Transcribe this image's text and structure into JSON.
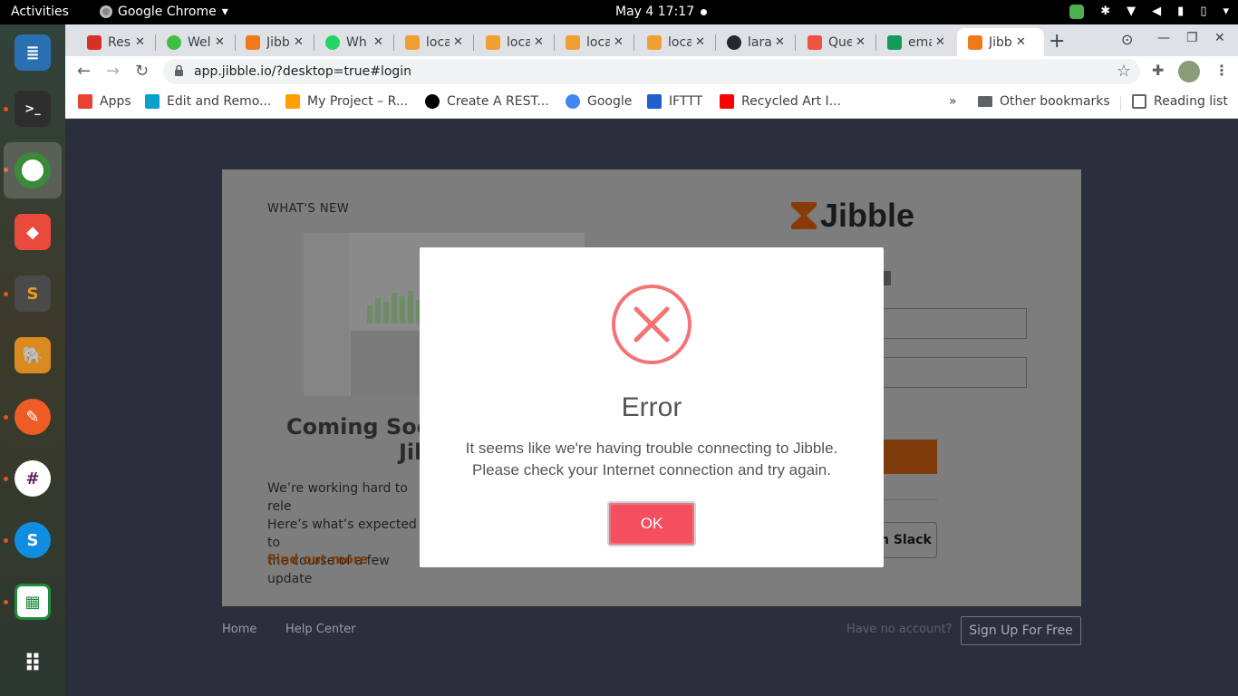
{
  "topbar": {
    "activities": "Activities",
    "app_name": "Google Chrome",
    "clock": "May 4  17:17"
  },
  "dock": {
    "items": [
      {
        "name": "text-editor-icon",
        "color": "#2a6fb0"
      },
      {
        "name": "terminal-icon",
        "color": "#2e2e2e"
      },
      {
        "name": "chrome-icon",
        "color": "#3a8a3a"
      },
      {
        "name": "anydesk-icon",
        "color": "#e84a3b"
      },
      {
        "name": "sublime-text-icon",
        "color": "#4a4a4a"
      },
      {
        "name": "dbeaver-icon",
        "color": "#d98a20"
      },
      {
        "name": "postman-icon",
        "color": "#ef5b25"
      },
      {
        "name": "slack-icon",
        "color": "#ffffff"
      },
      {
        "name": "skype-icon",
        "color": "#0f8de0"
      },
      {
        "name": "spreadsheet-icon",
        "color": "#1f8a3a"
      },
      {
        "name": "app-grid-icon",
        "color": "#ffffff"
      }
    ]
  },
  "tabs": [
    {
      "label": "Res",
      "favicon": "gmail-icon",
      "color": "#d93025"
    },
    {
      "label": "Wel",
      "favicon": "green-dot-icon",
      "color": "#3fbf3f"
    },
    {
      "label": "Jibb",
      "favicon": "jibble-icon",
      "color": "#f07a1a"
    },
    {
      "label": "Wh",
      "favicon": "whatsapp-icon",
      "color": "#25d366"
    },
    {
      "label": "loca",
      "favicon": "phpmyadmin-icon",
      "color": "#f0a030"
    },
    {
      "label": "loca",
      "favicon": "phpmyadmin-icon",
      "color": "#f0a030"
    },
    {
      "label": "loca",
      "favicon": "phpmyadmin-icon",
      "color": "#f0a030"
    },
    {
      "label": "loca",
      "favicon": "phpmyadmin-icon",
      "color": "#f0a030"
    },
    {
      "label": "lara",
      "favicon": "github-icon",
      "color": "#24292e"
    },
    {
      "label": "Que",
      "favicon": "laravel-icon",
      "color": "#f05340"
    },
    {
      "label": "ema",
      "favicon": "sheets-icon",
      "color": "#0f9d58"
    },
    {
      "label": "Jibb",
      "favicon": "jibble-icon",
      "color": "#f07a1a"
    }
  ],
  "address_bar": {
    "url": "app.jibble.io/?desktop=true#login"
  },
  "bookmarks": [
    {
      "label": "Apps",
      "icon": "apps-grid-icon",
      "color": "#e94235"
    },
    {
      "label": "Edit and Remo...",
      "icon": "bookmark-favicon",
      "color": "#0aa0c8"
    },
    {
      "label": "My Project – R...",
      "icon": "firebase-icon",
      "color": "#ffa000"
    },
    {
      "label": "Create A REST...",
      "icon": "medium-icon",
      "color": "#000000"
    },
    {
      "label": "Google",
      "icon": "google-icon",
      "color": "#4285f4"
    },
    {
      "label": "IFTTT",
      "icon": "ifttt-icon",
      "color": "#1f5fd0"
    },
    {
      "label": "Recycled Art I...",
      "icon": "youtube-icon",
      "color": "#ff0000"
    }
  ],
  "bookmarks_right": {
    "overflow": "»",
    "other": "Other bookmarks",
    "reading_list": "Reading list"
  },
  "page": {
    "whats_new": "WHAT'S NEW",
    "coming_soon_line1": "Coming Soon",
    "coming_soon_line2": "Jib",
    "body_lines": [
      "We’re working hard to rele",
      "Here’s what’s expected to",
      "the course of a few update"
    ],
    "find_out_more": "Find out more",
    "logo_text": "Jibble",
    "slack_fragment": "n Slack",
    "footer": {
      "home": "Home",
      "help": "Help Center",
      "no_account": "Have no account?",
      "signup": "Sign Up For Free"
    }
  },
  "modal": {
    "title": "Error",
    "message_line1": "It seems like we're having trouble connecting to Jibble.",
    "message_line2": "Please check your Internet connection and try again.",
    "ok_label": "OK",
    "accent_color": "#f27474"
  }
}
